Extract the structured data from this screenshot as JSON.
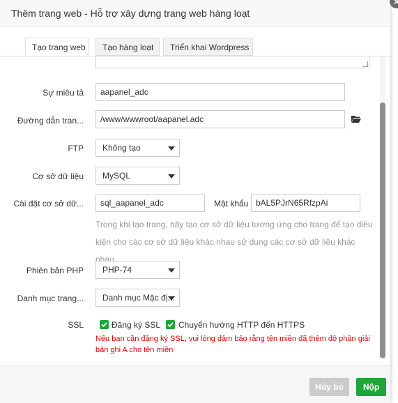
{
  "dialog": {
    "title": "Thêm trang web - Hỗ trợ xây dựng trang web hàng loạt",
    "close_glyph": "×"
  },
  "tabs": [
    {
      "label": "Tạo trang web",
      "active": true
    },
    {
      "label": "Tạo hàng loạt",
      "active": false
    },
    {
      "label": "Triển khai Wordpress",
      "active": false
    }
  ],
  "form": {
    "description": {
      "label": "Sự miêu tả",
      "value": "aapanel_adc"
    },
    "path": {
      "label": "Đường dẫn tran...",
      "value": "/www/wwwroot/aapanel.adc",
      "icon": "folder-open-icon"
    },
    "ftp": {
      "label": "FTP",
      "selected": "Không tạo"
    },
    "database": {
      "label": "Cơ sở dữ liệu",
      "selected": "MySQL"
    },
    "db_settings": {
      "label": "Cài đặt cơ sở dữ...",
      "db_name": "sql_aapanel_adc",
      "password_label": "Mật khẩu",
      "password": "bAL5PJrN65RfzpAi",
      "hint_line1": "Trong khi tạo trang, hãy tạo cơ sở dữ liệu tương ứng cho trang để tạo điều",
      "hint_line2": "kiện cho các cơ sở dữ liệu khác nhau sử dụng các cơ sở dữ liệu khác nhau."
    },
    "php": {
      "label": "Phiên bản PHP",
      "selected": "PHP-74"
    },
    "category": {
      "label": "Danh mục trang...",
      "selected": "Danh mục Mặc đị..."
    },
    "ssl": {
      "label": "SSL",
      "register_label": "Đăng ký SSL",
      "register_checked": true,
      "redirect_label": "Chuyển hướng HTTP đến HTTPS",
      "redirect_checked": true,
      "warning": "Nếu bạn cần đăng ký SSL, vui lòng đảm bảo rằng tên miền đã thêm độ phân giải bản ghi A cho tên miền"
    }
  },
  "footer": {
    "cancel_label": "Hủy bỏ",
    "submit_label": "Nộp"
  },
  "colors": {
    "accent": "#20a53a",
    "warning": "#e40000",
    "cancel_bg": "#cbcbcb"
  }
}
